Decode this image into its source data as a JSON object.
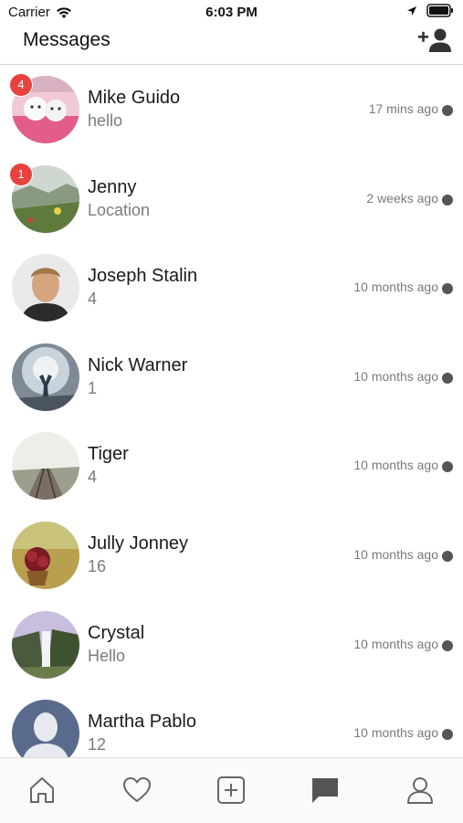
{
  "status_bar": {
    "carrier": "Carrier",
    "time": "6:03 PM"
  },
  "header": {
    "title": "Messages",
    "add_user_icon": "add-user-icon"
  },
  "conversations": [
    {
      "name": "Mike Guido",
      "message": "hello",
      "time": "17 mins ago",
      "badge": "4"
    },
    {
      "name": "Jenny",
      "message": "Location",
      "time": "2 weeks ago",
      "badge": "1"
    },
    {
      "name": "Joseph Stalin",
      "message": "4",
      "time": "10 months ago"
    },
    {
      "name": "Nick Warner",
      "message": "1",
      "time": "10 months ago"
    },
    {
      "name": "Tiger",
      "message": "4",
      "time": "10 months ago"
    },
    {
      "name": "Jully Jonney",
      "message": "16",
      "time": "10 months ago"
    },
    {
      "name": "Crystal",
      "message": "Hello",
      "time": "10 months ago"
    },
    {
      "name": "Martha Pablo",
      "message": "12",
      "time": "10 months ago"
    }
  ],
  "tabs": [
    "home-icon",
    "heart-icon",
    "add-post-icon",
    "chat-bubble-icon",
    "profile-icon"
  ],
  "colors": {
    "badge": "#e8423f",
    "status_dot": "#555555",
    "active_tab": "#555555"
  }
}
